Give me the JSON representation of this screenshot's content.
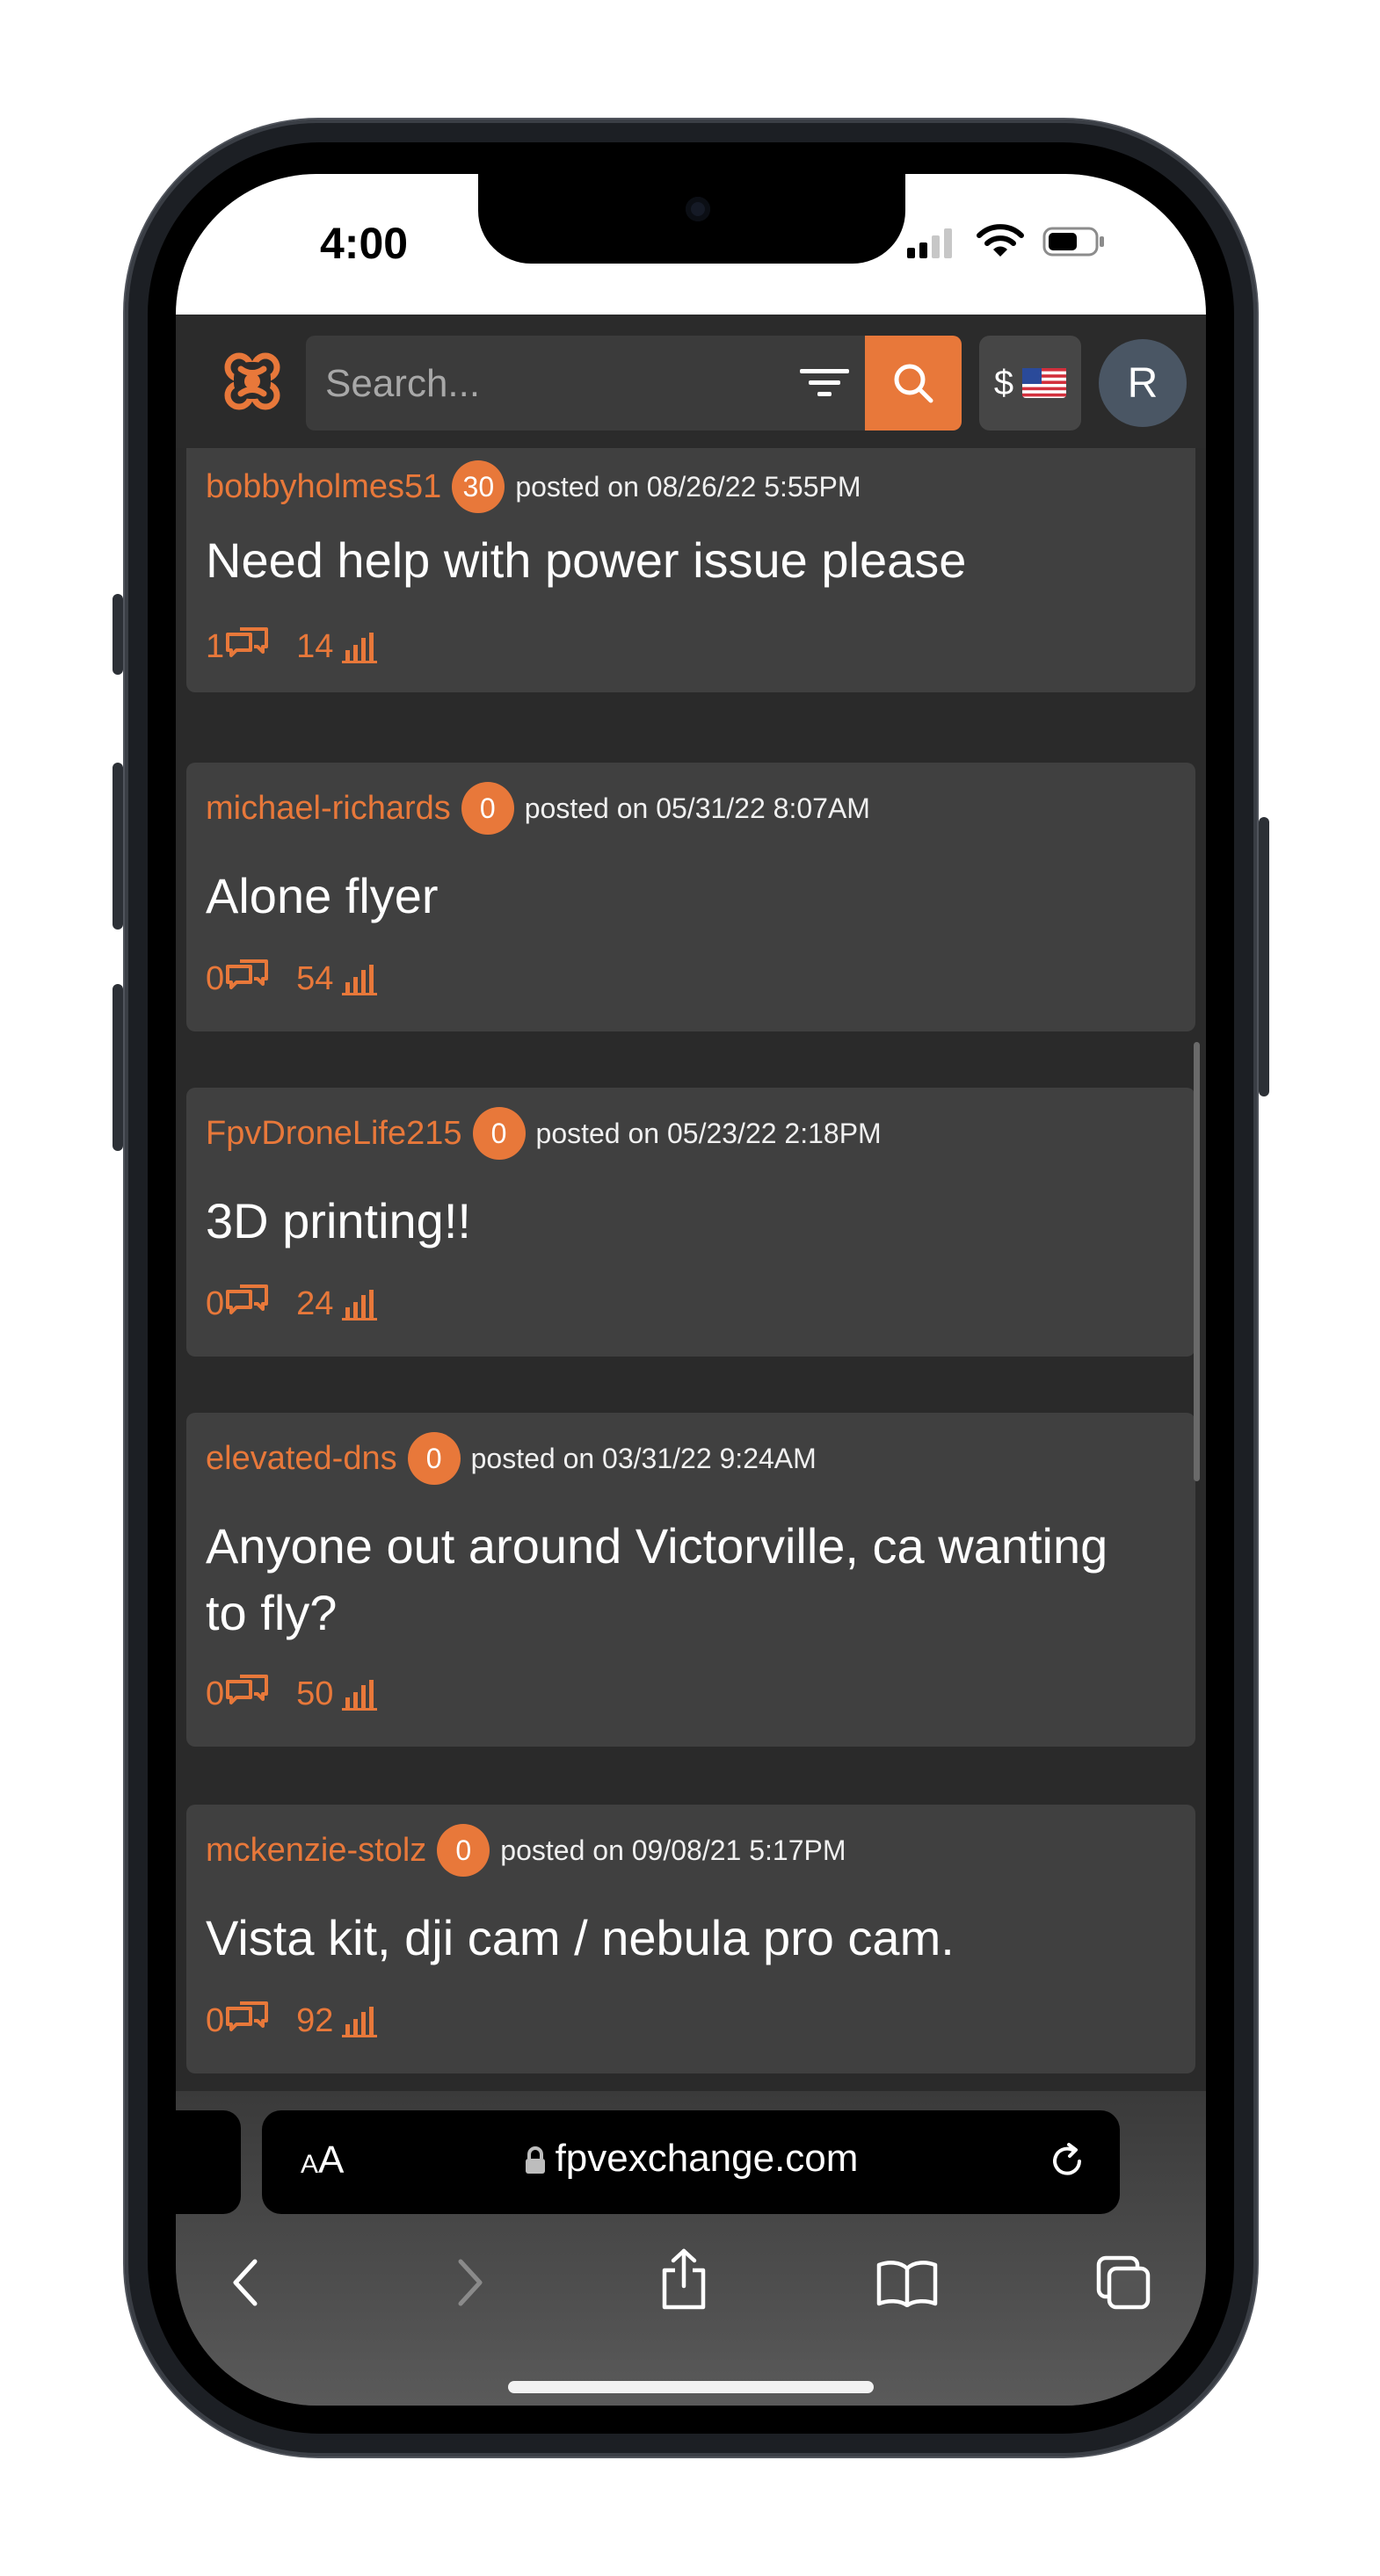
{
  "status_bar": {
    "time": "4:00"
  },
  "header": {
    "search_placeholder": "Search...",
    "currency_symbol": "$",
    "avatar_initial": "R"
  },
  "posts": [
    {
      "username": "bobbyholmes51",
      "reputation": "30",
      "posted": "posted on 08/26/22 5:55PM",
      "title": "Need help with power issue please",
      "replies": "1",
      "views": "14"
    },
    {
      "username": "michael-richards",
      "reputation": "0",
      "posted": "posted on 05/31/22 8:07AM",
      "title": "Alone flyer",
      "replies": "0",
      "views": "54"
    },
    {
      "username": "FpvDroneLife215",
      "reputation": "0",
      "posted": "posted on 05/23/22 2:18PM",
      "title": "3D printing!!",
      "replies": "0",
      "views": "24"
    },
    {
      "username": "elevated-dns",
      "reputation": "0",
      "posted": "posted on 03/31/22 9:24AM",
      "title": "Anyone out around Victorville, ca wanting to fly?",
      "replies": "0",
      "views": "50"
    },
    {
      "username": "mckenzie-stolz",
      "reputation": "0",
      "posted": "posted on 09/08/21 5:17PM",
      "title": "Vista kit, dji cam / nebula pro cam.",
      "replies": "0",
      "views": "92"
    }
  ],
  "browser": {
    "aa_small": "A",
    "aa_large": "A",
    "url": "fpvexchange.com"
  },
  "colors": {
    "accent": "#e8783a",
    "card": "#404040",
    "background": "#2a2a2a"
  }
}
